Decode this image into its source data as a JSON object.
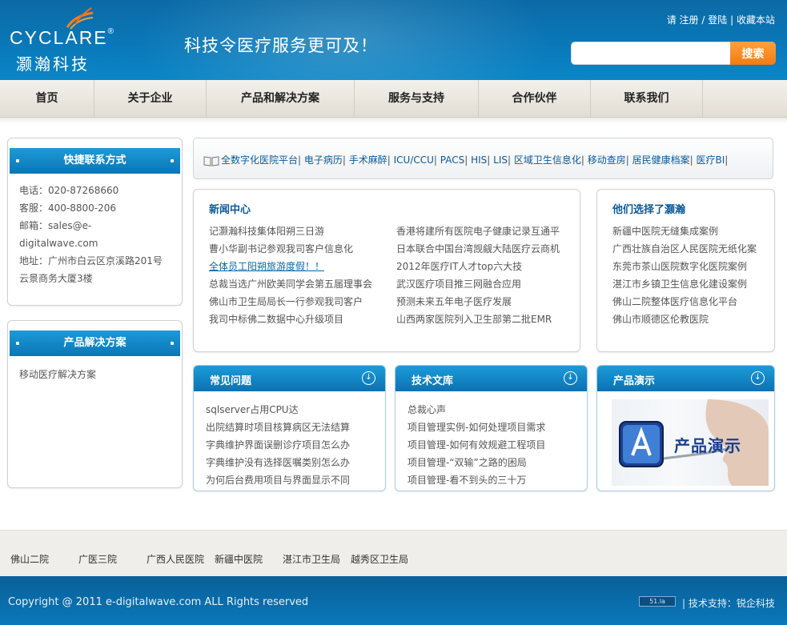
{
  "header": {
    "logo_en": "CYCLARE",
    "logo_reg": "®",
    "logo_cn": "灏瀚科技",
    "slogan": "科技令医疗服务更可及！",
    "top_links": [
      "请",
      "注册",
      "/",
      "登陆",
      "|",
      "收藏本站"
    ],
    "search": {
      "placeholder": "",
      "button": "搜索"
    }
  },
  "nav": [
    "首页",
    "关于企业",
    "产品和解决方案",
    "服务与支持",
    "合作伙伴",
    "联系我们"
  ],
  "sidebar": {
    "contact": {
      "title": "快捷联系方式",
      "lines": [
        "电话：020-87268660",
        "客服：400-8800-206",
        "邮箱：sales@e-",
        "digitalwave.com",
        "地址：广州市白云区京溪路201号",
        "云景商务大厦3楼"
      ]
    },
    "solutions": {
      "title": "产品解决方案",
      "items": [
        "移动医疗解决方案"
      ]
    }
  },
  "keywords": [
    "全数字化医院平台",
    "电子病历",
    "手术麻醉",
    "ICU/CCU",
    "PACS",
    "HIS",
    "LIS",
    "区域卫生信息化",
    "移动查房",
    "居民健康档案",
    "医疗BI"
  ],
  "news": {
    "title": "新闻中心",
    "left": [
      "记灏瀚科技集体阳朔三日游",
      "曹小华副书记参观我司客户信息化",
      "全体员工阳朔旅游度假！！",
      "总裁当选广州欧美同学会第五届理事会",
      "佛山市卫生局局长一行参观我司客户",
      "我司中标佛二数据中心升级项目"
    ],
    "right": [
      "香港将建所有医院电子健康记录互通平",
      "日本联合中国台湾觊觎大陆医疗云商机",
      "2012年医疗IT人才top六大技",
      "武汉医疗项目推三网融合应用",
      "预测未来五年电子医疗发展",
      "山西两家医院列入卫生部第二批EMR"
    ]
  },
  "cases": {
    "title": "他们选择了灏瀚",
    "items": [
      "新疆中医院无缝集成案例",
      "广西壮族自治区人民医院无纸化案",
      "东莞市茶山医院数字化医院案例",
      "湛江市乡镇卫生信息化建设案例",
      "佛山二院整体医疗信息化平台",
      "佛山市顺德区伦教医院"
    ]
  },
  "faq": {
    "title": "常见问题",
    "items": [
      "sqlserver占用CPU达",
      "出院结算时项目核算病区无法结算",
      "字典维护界面误删诊疗项目怎么办",
      "字典维护没有选择医嘱类别怎么办",
      "为何后台费用项目与界面显示不同"
    ]
  },
  "docs": {
    "title": "技术文库",
    "items": [
      "总裁心声",
      "项目管理实例-如何处理项目需求",
      "项目管理-如何有效规避工程项目",
      "项目管理-“双输”之路的困局",
      "项目管理-看不到头的三十万"
    ]
  },
  "demo": {
    "title": "产品演示",
    "image_text": "产品演示"
  },
  "footer": {
    "links": [
      "佛山二院",
      "广医三院",
      "广西人民医院",
      "新疆中医院",
      "湛江市卫生局",
      "越秀区卫生局"
    ],
    "copyright": "Copyright @ 2011 e-digitalwave.com ALL Rights reserved",
    "badge": "51.la",
    "tech_support": "| 技术支持：锐企科技"
  },
  "colors": {
    "header_blue": "#0a78b8",
    "accent_orange": "#f07c10",
    "link_blue": "#0b5a9a"
  }
}
